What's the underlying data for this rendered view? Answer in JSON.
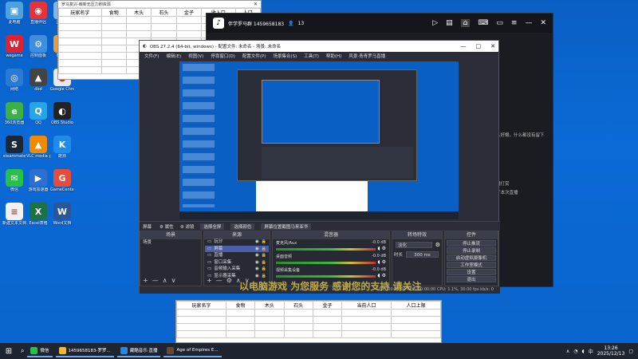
{
  "desktop": {
    "icons": [
      {
        "label": "此电脑",
        "color": "#4aa3df",
        "glyph": "▣"
      },
      {
        "label": "直播伴侣",
        "color": "#e8323a",
        "glyph": "◉"
      },
      {
        "label": "回收站",
        "color": "#7fb8e6",
        "glyph": "♲"
      },
      {
        "label": "wegame",
        "color": "#d23",
        "glyph": "W"
      },
      {
        "label": "控制面板",
        "color": "#3e8ee0",
        "glyph": "⚙"
      },
      {
        "label": "Maple",
        "color": "#f29a2e",
        "glyph": "M"
      },
      {
        "label": "网络",
        "color": "#2a7ad2",
        "glyph": "◎"
      },
      {
        "label": "dbd",
        "color": "#444",
        "glyph": "▲"
      },
      {
        "label": "Google Chrome",
        "color": "#e9e9e9",
        "glyph": "●"
      },
      {
        "label": "360浏览器",
        "color": "#3cb043",
        "glyph": "e"
      },
      {
        "label": "QQ",
        "color": "#27a6e6",
        "glyph": "Q"
      },
      {
        "label": "OBS Studio",
        "color": "#222",
        "glyph": "◐"
      },
      {
        "label": "steammate",
        "color": "#1b2838",
        "glyph": "S"
      },
      {
        "label": "VLC media player",
        "color": "#f08a00",
        "glyph": "▲"
      },
      {
        "label": "酷狗",
        "color": "#1f8ceb",
        "glyph": "K"
      },
      {
        "label": "微信",
        "color": "#27c04a",
        "glyph": "✉"
      },
      {
        "label": "游戏加速器",
        "color": "#2d6fd1",
        "glyph": "▶"
      },
      {
        "label": "GameCenter",
        "color": "#e74b3c",
        "glyph": "G"
      },
      {
        "label": "新建文本文档",
        "color": "#f1f1f1",
        "glyph": "≡"
      },
      {
        "label": "Excel表格",
        "color": "#1e7145",
        "glyph": "X"
      },
      {
        "label": "Word文档",
        "color": "#2b579a",
        "glyph": "W"
      }
    ]
  },
  "top_sheet": {
    "title": "罗马复兴-萌新无压力刷资源",
    "columns": [
      "玩家名字",
      "食物",
      "木头",
      "石头",
      "金子",
      "收入口",
      "人口"
    ]
  },
  "douyin": {
    "title": "弹幕互动",
    "account": "伴学罗马群 1459658183",
    "count": "13",
    "right_panel_text": "这个人好懒，什么都没有留下",
    "right_panel_sub": "向主播打赏",
    "right_panel_note": "已开了本次直播"
  },
  "obs": {
    "title": "OBS 27.2.4 (64-bit, windows) - 配置文件: 未命名 - 场景: 未命名",
    "menu": [
      "文件(F)",
      "编辑(E)",
      "视图(V)",
      "停靠窗口(D)",
      "配置文件(P)",
      "场景集合(S)",
      "工具(T)",
      "帮助(H)",
      "风景·青青罗马直播"
    ],
    "scene_bar": {
      "label": "屏幕",
      "tabs": [
        "属性",
        "滤镜",
        "选择全屏",
        "选择颜色",
        "屏幕位置截图马来亚华"
      ]
    },
    "panels": {
      "scenes": "场景",
      "sources": "来源",
      "mixer": "混音器",
      "transitions": "转场特效",
      "controls": "控件"
    },
    "scenes_list": [
      "场景"
    ],
    "sources_list": [
      "玩分",
      "屏幕",
      "直播",
      "窗口采集",
      "音频输入采集",
      "显示器采集"
    ],
    "mixer_tracks": [
      {
        "name": "麦克风/Aux",
        "db": "-0.0 dB"
      },
      {
        "name": "桌面音频",
        "db": "-0.0 dB"
      },
      {
        "name": "视频采集设备",
        "db": "-0.0 dB"
      }
    ],
    "transition": {
      "select": "淡化",
      "duration_label": "时长",
      "duration": "300 ms"
    },
    "controls": [
      "停止推流",
      "停止录制",
      "启动虚拟摄像机",
      "工作室模式",
      "设置",
      "退出"
    ],
    "status": "LIVE: 00:25:09   REC: 00:00:00   CPU: 1.1%, 30.00 fps   kb/s: 0",
    "overlay": "以电脑游戏 为您服务 感谢您的支持 请关注"
  },
  "bottom_sheet": {
    "columns": [
      "玩家名字",
      "食物",
      "木头",
      "石头",
      "金子",
      "当前人口",
      "人口上限"
    ]
  },
  "taskbar": {
    "items": [
      {
        "label": "微信",
        "color": "#27c04a"
      },
      {
        "label": "1459658183-罗罗...",
        "color": "#f2b830"
      },
      {
        "label": "藏酷音乐·直播",
        "color": "#1f8ceb"
      },
      {
        "label": "Age of Empires E...",
        "color": "#6a4a2a"
      }
    ],
    "time": "13:26",
    "date": "2025/12/13",
    "lang": "中"
  }
}
